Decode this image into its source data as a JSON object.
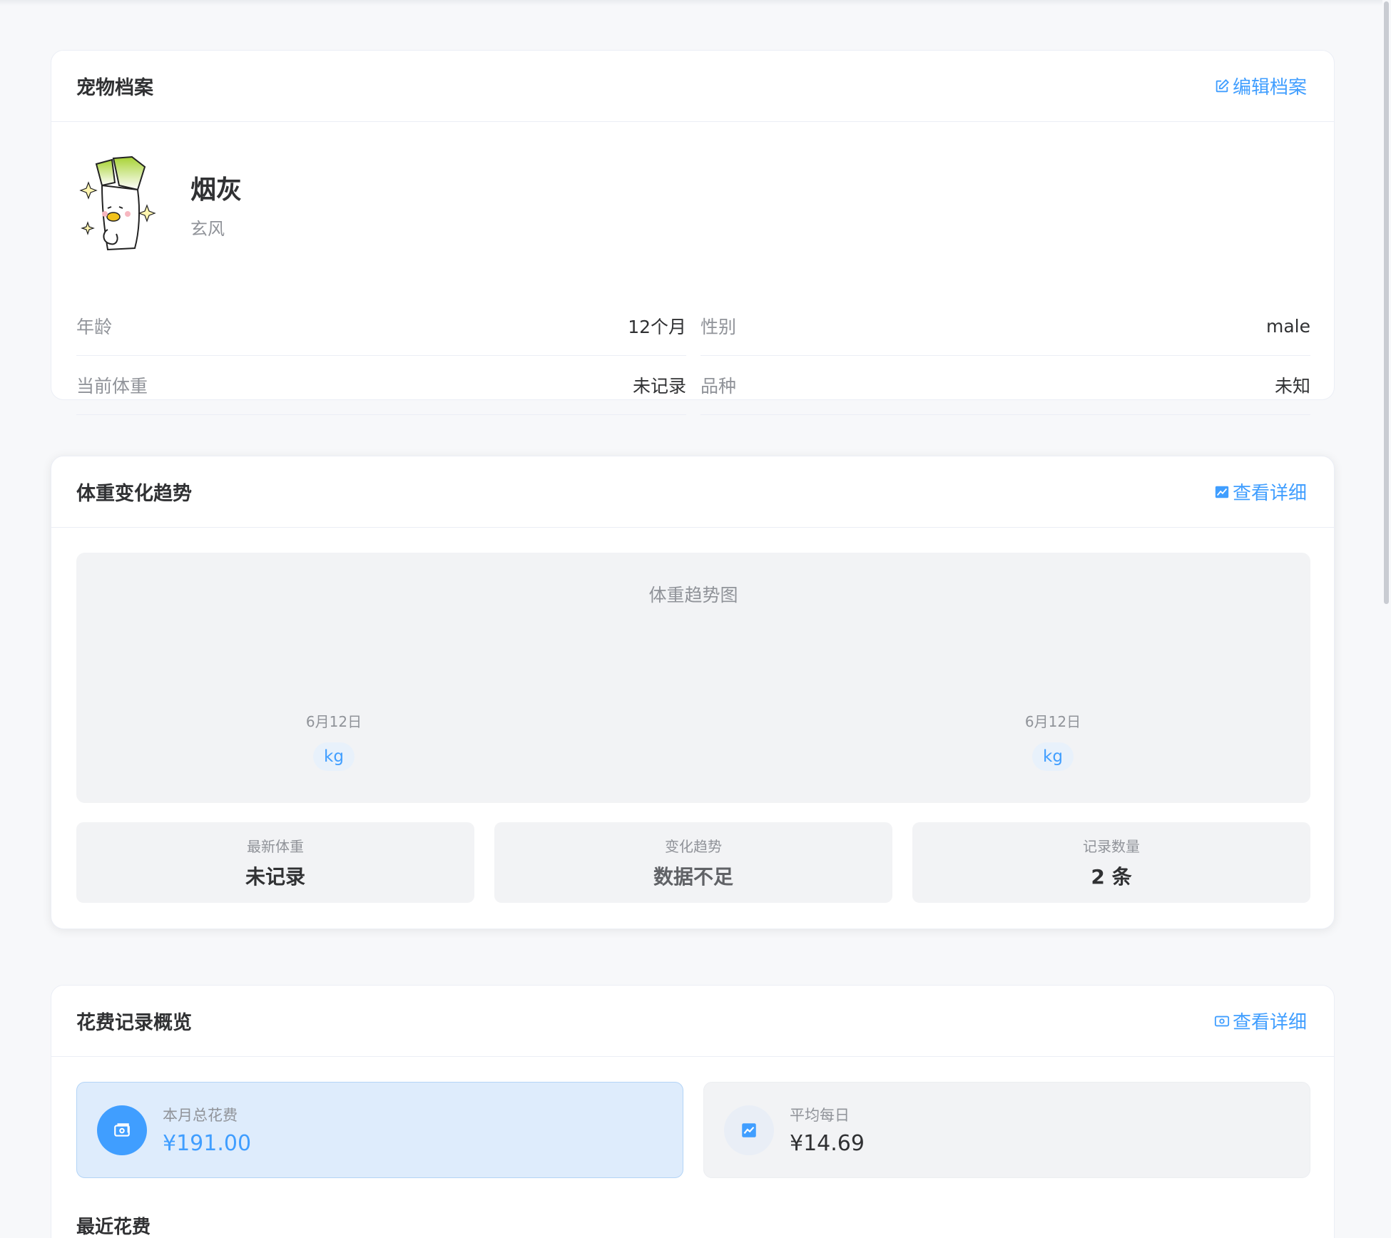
{
  "profile": {
    "title": "宠物档案",
    "edit_label": "编辑档案",
    "pet_name": "烟灰",
    "pet_breed": "玄风",
    "fields": [
      {
        "label": "年龄",
        "value": "12个月"
      },
      {
        "label": "性别",
        "value": "male"
      },
      {
        "label": "当前体重",
        "value": "未记录"
      },
      {
        "label": "品种",
        "value": "未知"
      }
    ]
  },
  "weight": {
    "title": "体重变化趋势",
    "detail_label": "查看详细",
    "chart_title": "体重趋势图",
    "stats": [
      {
        "label": "最新体重",
        "value": "未记录"
      },
      {
        "label": "变化趋势",
        "value": "数据不足"
      },
      {
        "label": "记录数量",
        "value": "2 条"
      }
    ]
  },
  "chart_data": {
    "type": "scatter",
    "title": "体重趋势图",
    "categories": [
      "6月12日",
      "6月12日"
    ],
    "point_labels": [
      "kg",
      "kg"
    ],
    "values": [
      null,
      null
    ],
    "xlabel": "",
    "ylabel": ""
  },
  "spending": {
    "title": "花费记录概览",
    "detail_label": "查看详细",
    "monthly_label": "本月总花费",
    "monthly_value": "¥191.00",
    "daily_label": "平均每日",
    "daily_value": "¥14.69",
    "recent_title": "最近花费"
  },
  "colors": {
    "accent": "#409eff",
    "background": "#f7f8fa",
    "text": "#303133",
    "muted": "#909399"
  }
}
